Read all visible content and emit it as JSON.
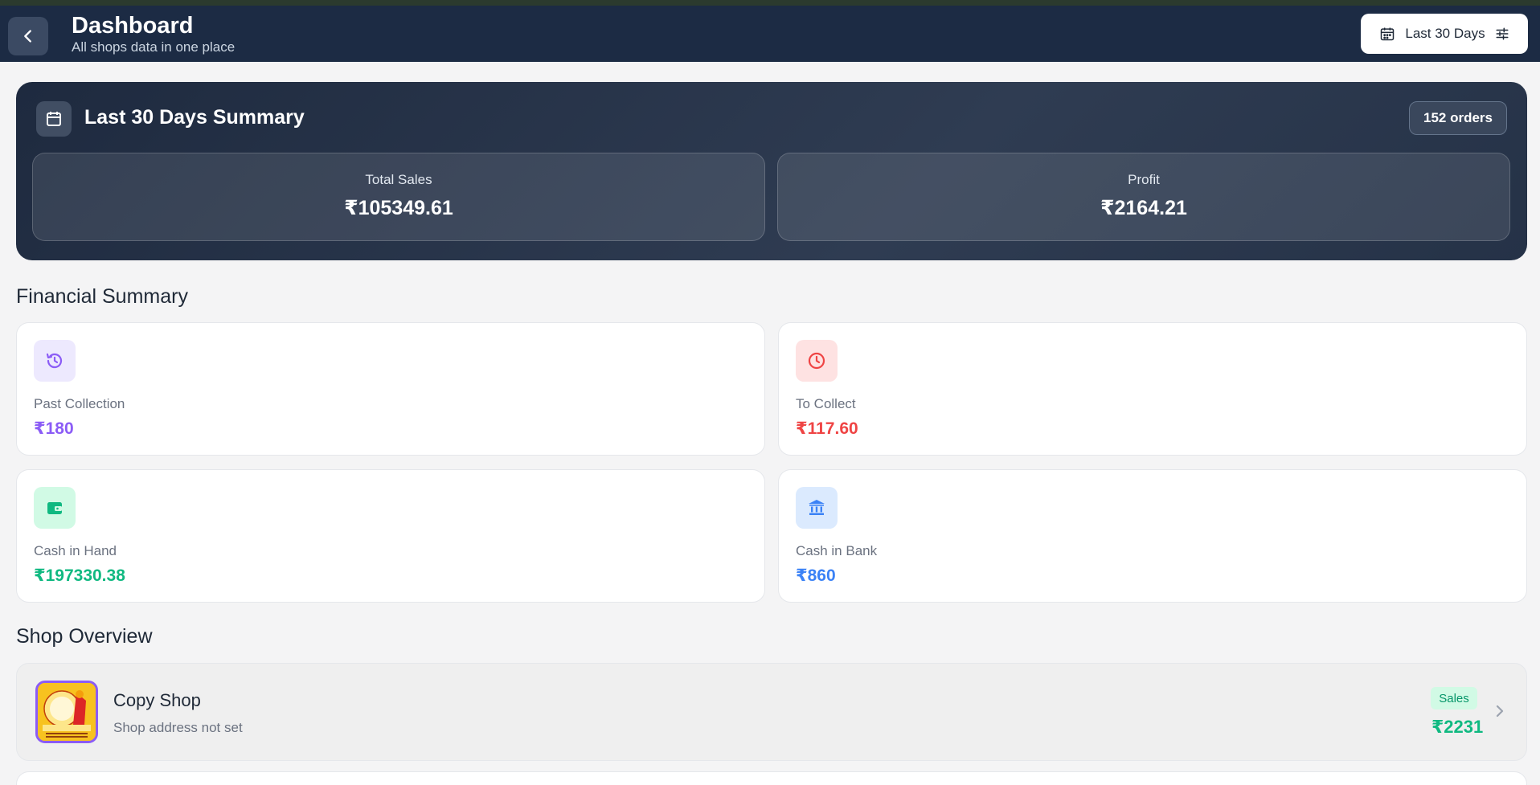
{
  "header": {
    "title": "Dashboard",
    "subtitle": "All shops data in one place",
    "date_filter": "Last 30 Days"
  },
  "summary": {
    "title": "Last 30 Days Summary",
    "orders": "152 orders",
    "total_sales_label": "Total Sales",
    "total_sales_value": "₹105349.61",
    "profit_label": "Profit",
    "profit_value": "₹2164.21"
  },
  "financial": {
    "title": "Financial Summary",
    "items": [
      {
        "label": "Past Collection",
        "value": "₹180",
        "color": "#8b5cf6",
        "icon": "history-icon"
      },
      {
        "label": "To Collect",
        "value": "₹117.60",
        "color": "#ef4444",
        "icon": "clock-icon"
      },
      {
        "label": "Cash in Hand",
        "value": "₹197330.38",
        "color": "#10b981",
        "icon": "wallet-icon"
      },
      {
        "label": "Cash in Bank",
        "value": "₹860",
        "color": "#3b82f6",
        "icon": "bank-icon"
      }
    ]
  },
  "shops": {
    "title": "Shop Overview",
    "items": [
      {
        "name": "Copy Shop",
        "address": "Shop address not set",
        "badge": "Sales",
        "value": "₹2231"
      }
    ]
  }
}
